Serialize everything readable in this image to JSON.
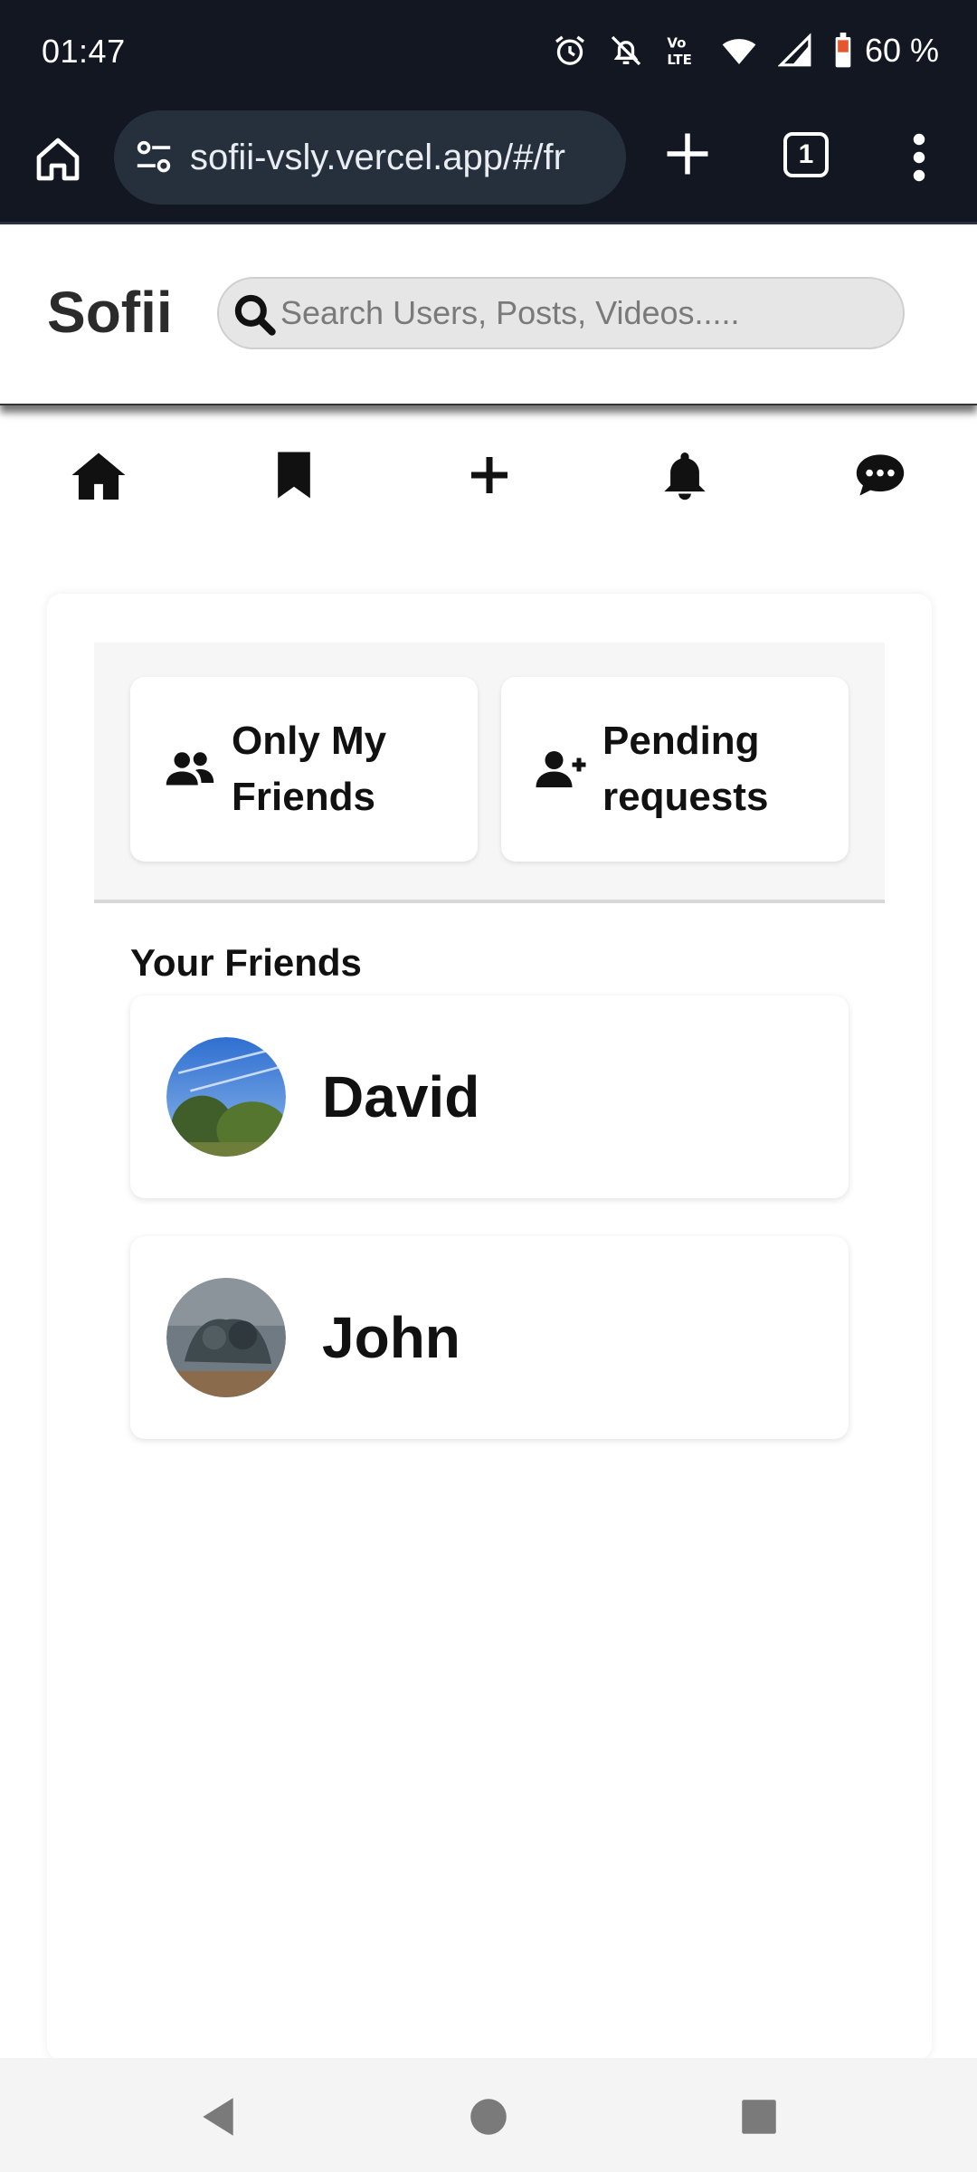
{
  "status_bar": {
    "time": "01:47",
    "battery": "60 %",
    "icons": [
      "alarm-icon",
      "bell-off-icon",
      "volte-icon",
      "wifi-icon",
      "signal-icon",
      "battery-icon"
    ]
  },
  "browser": {
    "url": "sofii-vsly.vercel.app/#/fr",
    "tab_count": "1"
  },
  "header": {
    "logo": "Sofii",
    "search_placeholder": "Search Users, Posts, Videos....."
  },
  "nav": {
    "items": [
      "home-icon",
      "bookmark-icon",
      "plus-icon",
      "bell-icon",
      "chat-icon"
    ]
  },
  "filters": [
    {
      "label": "Only My Friends",
      "icon": "users-icon"
    },
    {
      "label": "Pending requests",
      "icon": "user-plus-icon"
    }
  ],
  "friends_section": {
    "title": "Your Friends",
    "friends": [
      {
        "name": "David"
      },
      {
        "name": "John"
      }
    ]
  },
  "colors": {
    "status_bg": "#121722",
    "url_pill": "#26303d",
    "search_bg": "#e6e6e6",
    "card_bg": "#ffffff",
    "filter_area_bg": "#f6f6f6"
  }
}
